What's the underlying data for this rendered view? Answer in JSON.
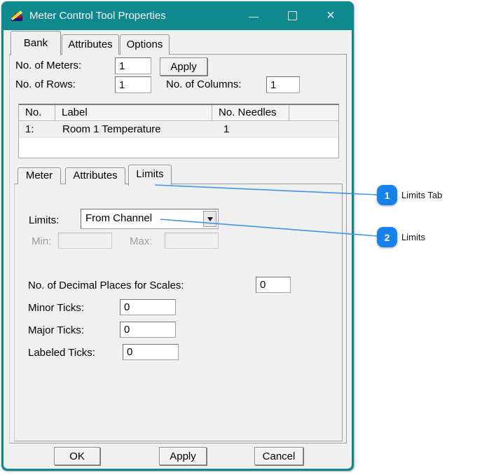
{
  "window": {
    "title": "Meter Control Tool Properties",
    "controls": {
      "minimize_glyph": "—",
      "close_glyph": "×"
    }
  },
  "outer_tabs": {
    "bank": "Bank",
    "attributes": "Attributes",
    "options": "Options"
  },
  "bank_panel": {
    "meters_label": "No. of Meters:",
    "meters_value": "1",
    "apply_button": "Apply",
    "rows_label": "No. of Rows:",
    "rows_value": "1",
    "columns_label": "No. of Columns:",
    "columns_value": "1",
    "meter_list": {
      "headers": {
        "no": "No.",
        "label": "Label",
        "needles": "No. Needles"
      },
      "rows": [
        {
          "no": "1:",
          "label": "Room 1 Temperature",
          "needles": "1"
        }
      ]
    }
  },
  "inner_tabs": {
    "meter": "Meter",
    "attributes": "Attributes",
    "limits": "Limits"
  },
  "limits_panel": {
    "limits_label": "Limits:",
    "limits_value": "From Channel",
    "min_label": "Min:",
    "max_label": "Max:",
    "decimal_label": "No. of Decimal Places for Scales:",
    "decimal_value": "0",
    "minor_label": "Minor Ticks:",
    "minor_value": "0",
    "major_label": "Major Ticks:",
    "major_value": "0",
    "labeled_label": "Labeled Ticks:",
    "labeled_value": "0"
  },
  "footer": {
    "ok": "OK",
    "apply": "Apply",
    "cancel": "Cancel"
  },
  "annotations": [
    {
      "number": "1",
      "label": "Limits Tab"
    },
    {
      "number": "2",
      "label": "Limits"
    }
  ],
  "colors": {
    "titlebar": "#0e8a8e",
    "badge": "#1581ea",
    "connector": "#3e96e9",
    "row_highlight": "#efefef"
  }
}
